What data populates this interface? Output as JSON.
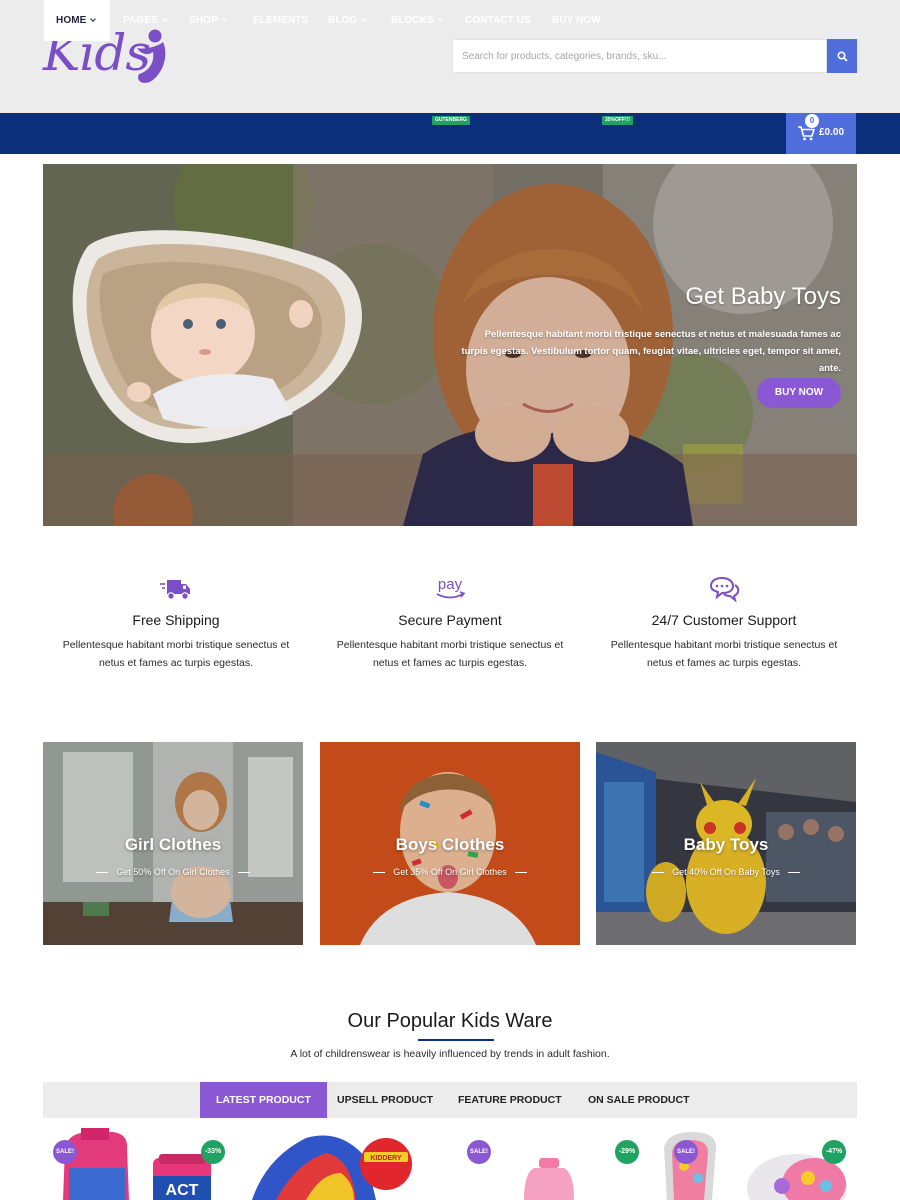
{
  "header": {
    "logo_text": "Kids",
    "search_placeholder": "Search for products, categories, brands, sku..."
  },
  "nav": {
    "items": [
      {
        "label": "HOME",
        "dropdown": true,
        "active": true
      },
      {
        "label": "PAGES",
        "dropdown": true
      },
      {
        "label": "SHOP",
        "dropdown": true
      },
      {
        "label": "ELEMENTS",
        "dropdown": false
      },
      {
        "label": "BLOG",
        "dropdown": true
      },
      {
        "label": "BLOCKS",
        "dropdown": true,
        "badge": "GUTENBERG"
      },
      {
        "label": "CONTACT US",
        "dropdown": false
      },
      {
        "label": "BUY NOW",
        "dropdown": false,
        "badge": "35%OFF!!!"
      }
    ],
    "cart": {
      "count": "0",
      "total": "£0.00"
    }
  },
  "hero": {
    "title": "Get Baby Toys",
    "text": "Pellentesque habitant morbi tristique senectus et netus et malesuada fames ac turpis egestas. Vestibulum tortor quam, feugiat vitae, ultricies eget, tempor sit amet, ante.",
    "button": "BUY NOW"
  },
  "features": [
    {
      "icon": "truck-icon",
      "title": "Free Shipping",
      "text": "Pellentesque habitant morbi tristique senectus et netus et fames ac turpis egestas."
    },
    {
      "icon": "pay-icon",
      "title": "Secure Payment",
      "text": "Pellentesque habitant morbi tristique senectus et netus et fames ac turpis egestas."
    },
    {
      "icon": "chat-icon",
      "title": "24/7 Customer Support",
      "text": "Pellentesque habitant morbi tristique senectus et netus et fames ac turpis egestas."
    }
  ],
  "categories": [
    {
      "title": "Girl Clothes",
      "subtitle": "Get 50% Off On Girl Clothes"
    },
    {
      "title": "Boys Clothes",
      "subtitle": "Get 35% Off On Girl Clothes"
    },
    {
      "title": "Baby Toys",
      "subtitle": "Get 40% Off On Baby Toys"
    }
  ],
  "popular": {
    "title": "Our Popular Kids Ware",
    "subtitle": "A lot of childrenswear is heavily influenced by trends in adult fashion.",
    "tabs": [
      "LATEST PRODUCT",
      "UPSELL PRODUCT",
      "FEATURE PRODUCT",
      "ON SALE PRODUCT"
    ]
  },
  "products": [
    {
      "sale_badge": "SALE!",
      "discount_badge": "-33%",
      "print": "ACT"
    },
    {
      "print": "KIDDERY"
    },
    {
      "sale_badge": "SALE!"
    },
    {
      "sale_badge": "SALE!",
      "discount_badge": "-29%"
    },
    {
      "discount_badge": "-47%"
    }
  ],
  "colors": {
    "accent": "#8a58d2",
    "nav_bg": "#0b2f7a",
    "cart_bg": "#4f6ddb",
    "badge_green": "#1ea362",
    "header_bg": "#ececec"
  }
}
